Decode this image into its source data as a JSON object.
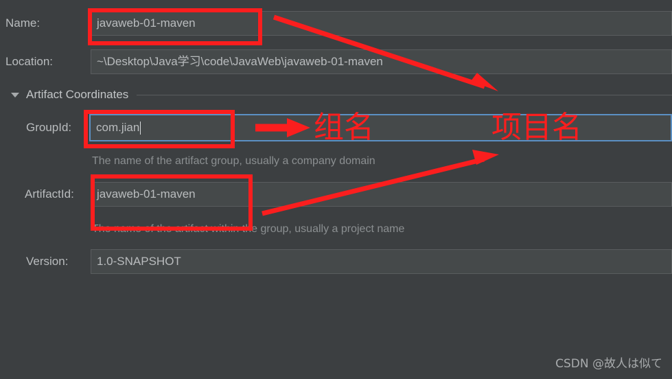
{
  "window": {
    "background_color": "#3c3f41",
    "field_background_color": "#45494a",
    "accent_focus_color": "#5b90c4",
    "annotation_color": "#fb1e1e"
  },
  "form": {
    "name": {
      "label": "Name:",
      "value": "javaweb-01-maven"
    },
    "location": {
      "label": "Location:",
      "value": "~\\Desktop\\Java学习\\code\\JavaWeb\\javaweb-01-maven"
    },
    "section": {
      "title": "Artifact Coordinates"
    },
    "group_id": {
      "label": "GroupId:",
      "value": "com.jian",
      "hint": "The name of the artifact group, usually a company domain"
    },
    "artifact_id": {
      "label": "ArtifactId:",
      "value": "javaweb-01-maven",
      "hint": "The name of the artifact within the group, usually a project name"
    },
    "version": {
      "label": "Version:",
      "value": "1.0-SNAPSHOT"
    }
  },
  "annotations": {
    "group_name_label": "组名",
    "project_name_label": "项目名"
  },
  "watermark": {
    "text": "CSDN @故人は似て"
  }
}
